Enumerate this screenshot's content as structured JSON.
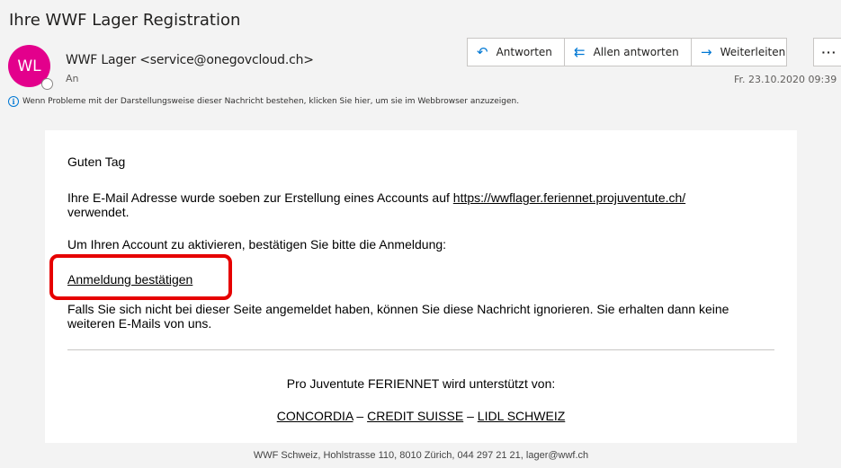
{
  "subject": "Ihre WWF Lager Registration",
  "sender": {
    "initials": "WL",
    "avatar_color": "#e3008c",
    "display": "WWF Lager <service@onegovcloud.ch>",
    "to_label": "An"
  },
  "actions": {
    "reply": "Antworten",
    "reply_all": "Allen antworten",
    "forward": "Weiterleiten",
    "more": "···"
  },
  "date": "Fr. 23.10.2020 09:39",
  "info_bar": "Wenn Probleme mit der Darstellungsweise dieser Nachricht bestehen, klicken Sie hier, um sie im Webbrowser anzuzeigen.",
  "body": {
    "greeting": "Guten Tag",
    "p1_before": "Ihre E-Mail Adresse wurde soeben zur Erstellung eines Accounts auf ",
    "p1_link": "https://wwflager.feriennet.projuventute.ch/",
    "p1_after": "verwendet.",
    "p2": "Um Ihren Account zu aktivieren, bestätigen Sie bitte die Anmeldung:",
    "confirm_link": "Anmeldung bestätigen",
    "p3_line1": "Falls Sie sich nicht bei dieser Seite angemeldet haben, können Sie diese Nachricht ignorieren. Sie erhalten dann keine",
    "p3_line2": "weiteren E-Mails von uns."
  },
  "sponsors": {
    "intro": "Pro Juventute FERIENNET wird unterstützt von:",
    "items": [
      "CONCORDIA",
      "CREDIT SUISSE",
      "LIDL SCHWEIZ"
    ],
    "separator": "–"
  },
  "footer": "WWF Schweiz, Hohlstrasse 110, 8010 Zürich, 044 297 21 21, lager@wwf.ch",
  "colors": {
    "accent": "#0078d4",
    "highlight_border": "#e60000"
  }
}
